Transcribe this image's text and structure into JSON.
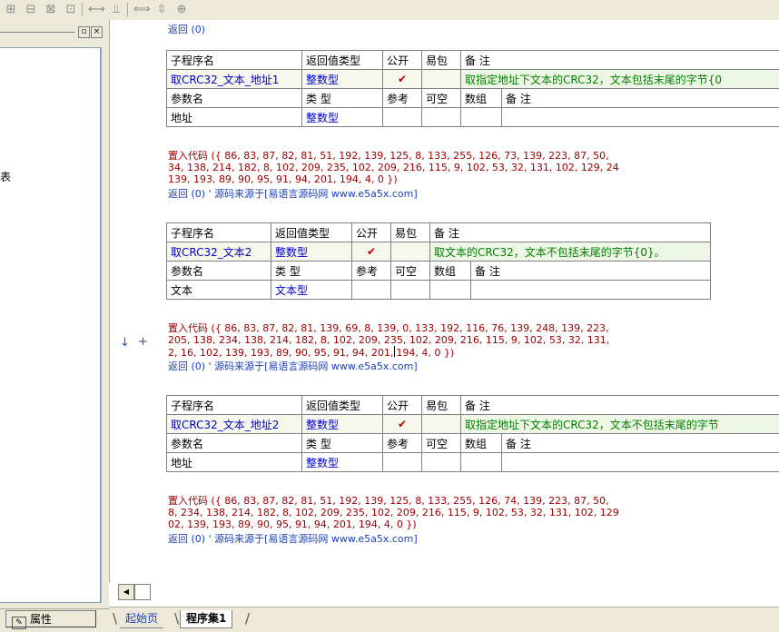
{
  "toolbar": {
    "icons": [
      "align-left-icon",
      "align-center-icon",
      "align-top-icon",
      "align-mid-icon",
      "hspace-icon",
      "vspace-icon",
      "same-width-icon",
      "same-height-icon",
      "same-size-icon"
    ],
    "glyphs": [
      "⊞",
      "⊟",
      "⊠",
      "⊡",
      "⟷",
      "⫫",
      "⟺",
      "⇳",
      "⊕"
    ]
  },
  "left_panel": {
    "close_glyph": "×",
    "restore_glyph": "▫",
    "tree_fragment": "表",
    "properties_label": "属性"
  },
  "tabs": {
    "home": "起始页",
    "current": "程序集1"
  },
  "code": {
    "top_return": "返回 (0)",
    "sub_header": {
      "name": "子程序名",
      "ret_type": "返回值类型",
      "public": "公开",
      "easy": "易包",
      "note": "备 注"
    },
    "param_header": {
      "name": "参数名",
      "type": "类 型",
      "ref": "参考",
      "nullable": "可空",
      "array": "数组",
      "note": "备 注"
    },
    "check": "✔",
    "gutter": {
      "arrow": "↓",
      "plus": "+"
    },
    "blocks": [
      {
        "func_name": "取CRC32_文本_地址1",
        "ret_type": "整数型",
        "note": "取指定地址下文本的CRC32，文本包括末尾的字节{0",
        "param_name": "地址",
        "param_type": "整数型",
        "code_line1": "置入代码 ({ 86, 83, 87, 82, 81, 51, 192, 139, 125, 8, 133, 255, 126, 73, 139, 223, 87, 50,",
        "code_line2": "34, 138, 214, 182, 8, 102, 209, 235, 102, 209, 216, 115, 9, 102, 53, 32, 131, 102, 129, 24",
        "code_line3": "139, 193, 89, 90, 95, 91, 94, 201, 194, 4, 0 })",
        "return_line": "返回 (0) ' 源码来源于[易语言源码网 www.e5a5x.com]"
      },
      {
        "func_name": "取CRC32_文本2",
        "ret_type": "整数型",
        "note": "取文本的CRC32，文本不包括末尾的字节{0}。",
        "param_name": "文本",
        "param_type": "文本型",
        "code_line1": "置入代码 ({ 86, 83, 87, 82, 81, 139, 69, 8, 139, 0, 133, 192, 116, 76, 139, 248, 139, 223,",
        "code_line2": "205, 138, 234, 138, 214, 182, 8, 102, 209, 235, 102, 209, 216, 115, 9, 102, 53, 32, 131,",
        "code_line3a": "2, 16, 102, 139, 193, 89, 90, 95, 91, 94, 201,",
        "code_line3b": "194, 4, 0 })",
        "return_line": "返回 (0) ' 源码来源于[易语言源码网 www.e5a5x.com]"
      },
      {
        "func_name": "取CRC32_文本_地址2",
        "ret_type": "整数型",
        "note": "取指定地址下文本的CRC32，文本不包括末尾的字节",
        "param_name": "地址",
        "param_type": "整数型",
        "code_line1": "置入代码 ({ 86, 83, 87, 82, 81, 51, 192, 139, 125, 8, 133, 255, 126, 74, 139, 223, 87, 50,",
        "code_line2": "8, 234, 138, 214, 182, 8, 102, 209, 235, 102, 209, 216, 115, 9, 102, 53, 32, 131, 102, 129",
        "code_line3": "02, 139, 193, 89, 90, 95, 91, 94, 201, 194, 4, 0 })",
        "return_line": "返回 (0) ' 源码来源于[易语言源码网 www.e5a5x.com]"
      }
    ]
  }
}
